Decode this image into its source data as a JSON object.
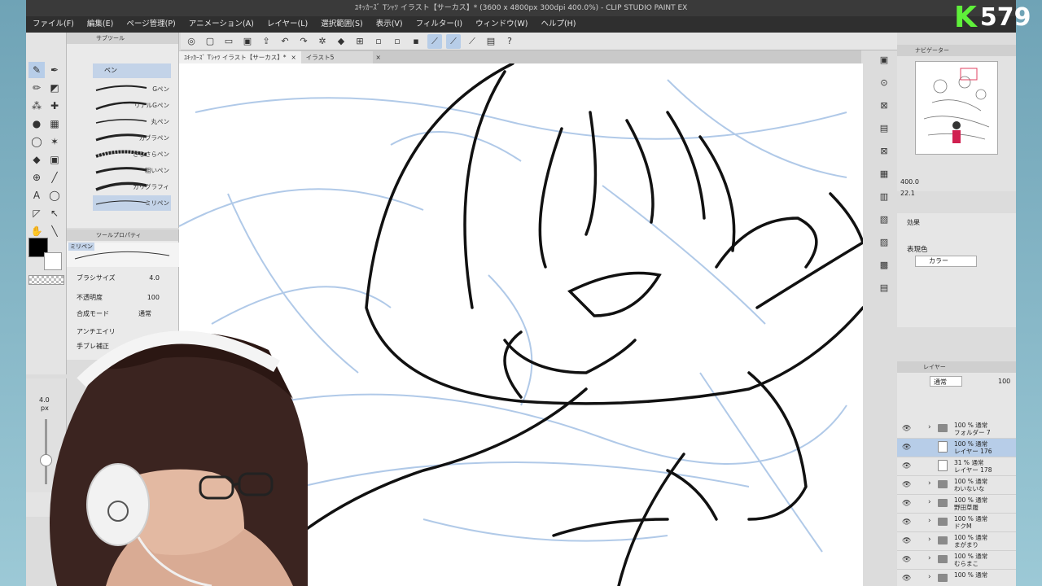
{
  "window": {
    "title": "ﾕｷｯｶｰｽﾞ Tｼｬﾂ イラスト【サーカス】* (3600 x 4800px 300dpi 400.0%) - CLIP STUDIO PAINT EX"
  },
  "menu": [
    "ファイル(F)",
    "編集(E)",
    "ページ管理(P)",
    "アニメーション(A)",
    "レイヤー(L)",
    "選択範囲(S)",
    "表示(V)",
    "フィルター(I)",
    "ウィンドウ(W)",
    "ヘルプ(H)"
  ],
  "tabs": [
    {
      "label": "ﾕｷｯｶｰｽﾞ Tｼｬﾂ イラスト【サーカス】*",
      "close": "×"
    },
    {
      "label": "イラスト5",
      "close": "×"
    }
  ],
  "subtool": {
    "header": "サブツール",
    "brushes": [
      "Gペン",
      "リアルGペン",
      "丸ペン",
      "カブラペン",
      "さらさらペン",
      "粗いペン",
      "カリグラフィ",
      "ミリペン"
    ]
  },
  "tool_property": {
    "header": "ツールプロパティ",
    "current": "ミリペン",
    "brush_size_label": "ブラシサイズ",
    "brush_size_value": "4.0",
    "opacity_label": "不透明度",
    "opacity_value": "100",
    "blend_label": "合成モード",
    "blend_value": "通常",
    "antialias_label": "アンチエイリ",
    "stabilize_label": "手ブレ補正"
  },
  "brush_size_panel": {
    "value": "4.0",
    "unit": "px"
  },
  "navigator": {
    "header": "ナビゲーター",
    "zoom": "400.0",
    "angle": "22.1"
  },
  "effect": {
    "header": "効果",
    "expression_label": "表現色",
    "expression_value": "カラー"
  },
  "layer_panel": {
    "header": "レイヤー",
    "blend": "通常",
    "opacity": "100",
    "layers": [
      {
        "top": "100 % 通常",
        "name": "フォルダー 7",
        "type": "folder",
        "selected": false
      },
      {
        "top": "100 % 通常",
        "name": "レイヤー 176",
        "type": "raster",
        "selected": true
      },
      {
        "top": "31 % 通常",
        "name": "レイヤー 178",
        "type": "raster",
        "selected": false
      },
      {
        "top": "100 % 通常",
        "name": "わいないな",
        "type": "folder",
        "selected": false
      },
      {
        "top": "100 % 通常",
        "name": "野田草履",
        "type": "folder",
        "selected": false
      },
      {
        "top": "100 % 通常",
        "name": "ドクM",
        "type": "folder",
        "selected": false
      },
      {
        "top": "100 % 通常",
        "name": "まがまり",
        "type": "folder",
        "selected": false
      },
      {
        "top": "100 % 通常",
        "name": "むらまこ",
        "type": "folder",
        "selected": false
      },
      {
        "top": "100 % 通常",
        "name": "",
        "type": "folder",
        "selected": false
      }
    ]
  },
  "logo": {
    "letter": "K",
    "number": "579"
  },
  "colors": {
    "main": "#000000",
    "sub": "#ffffff",
    "sketch": "#a8c4e6",
    "selection": "#b7cde8"
  }
}
